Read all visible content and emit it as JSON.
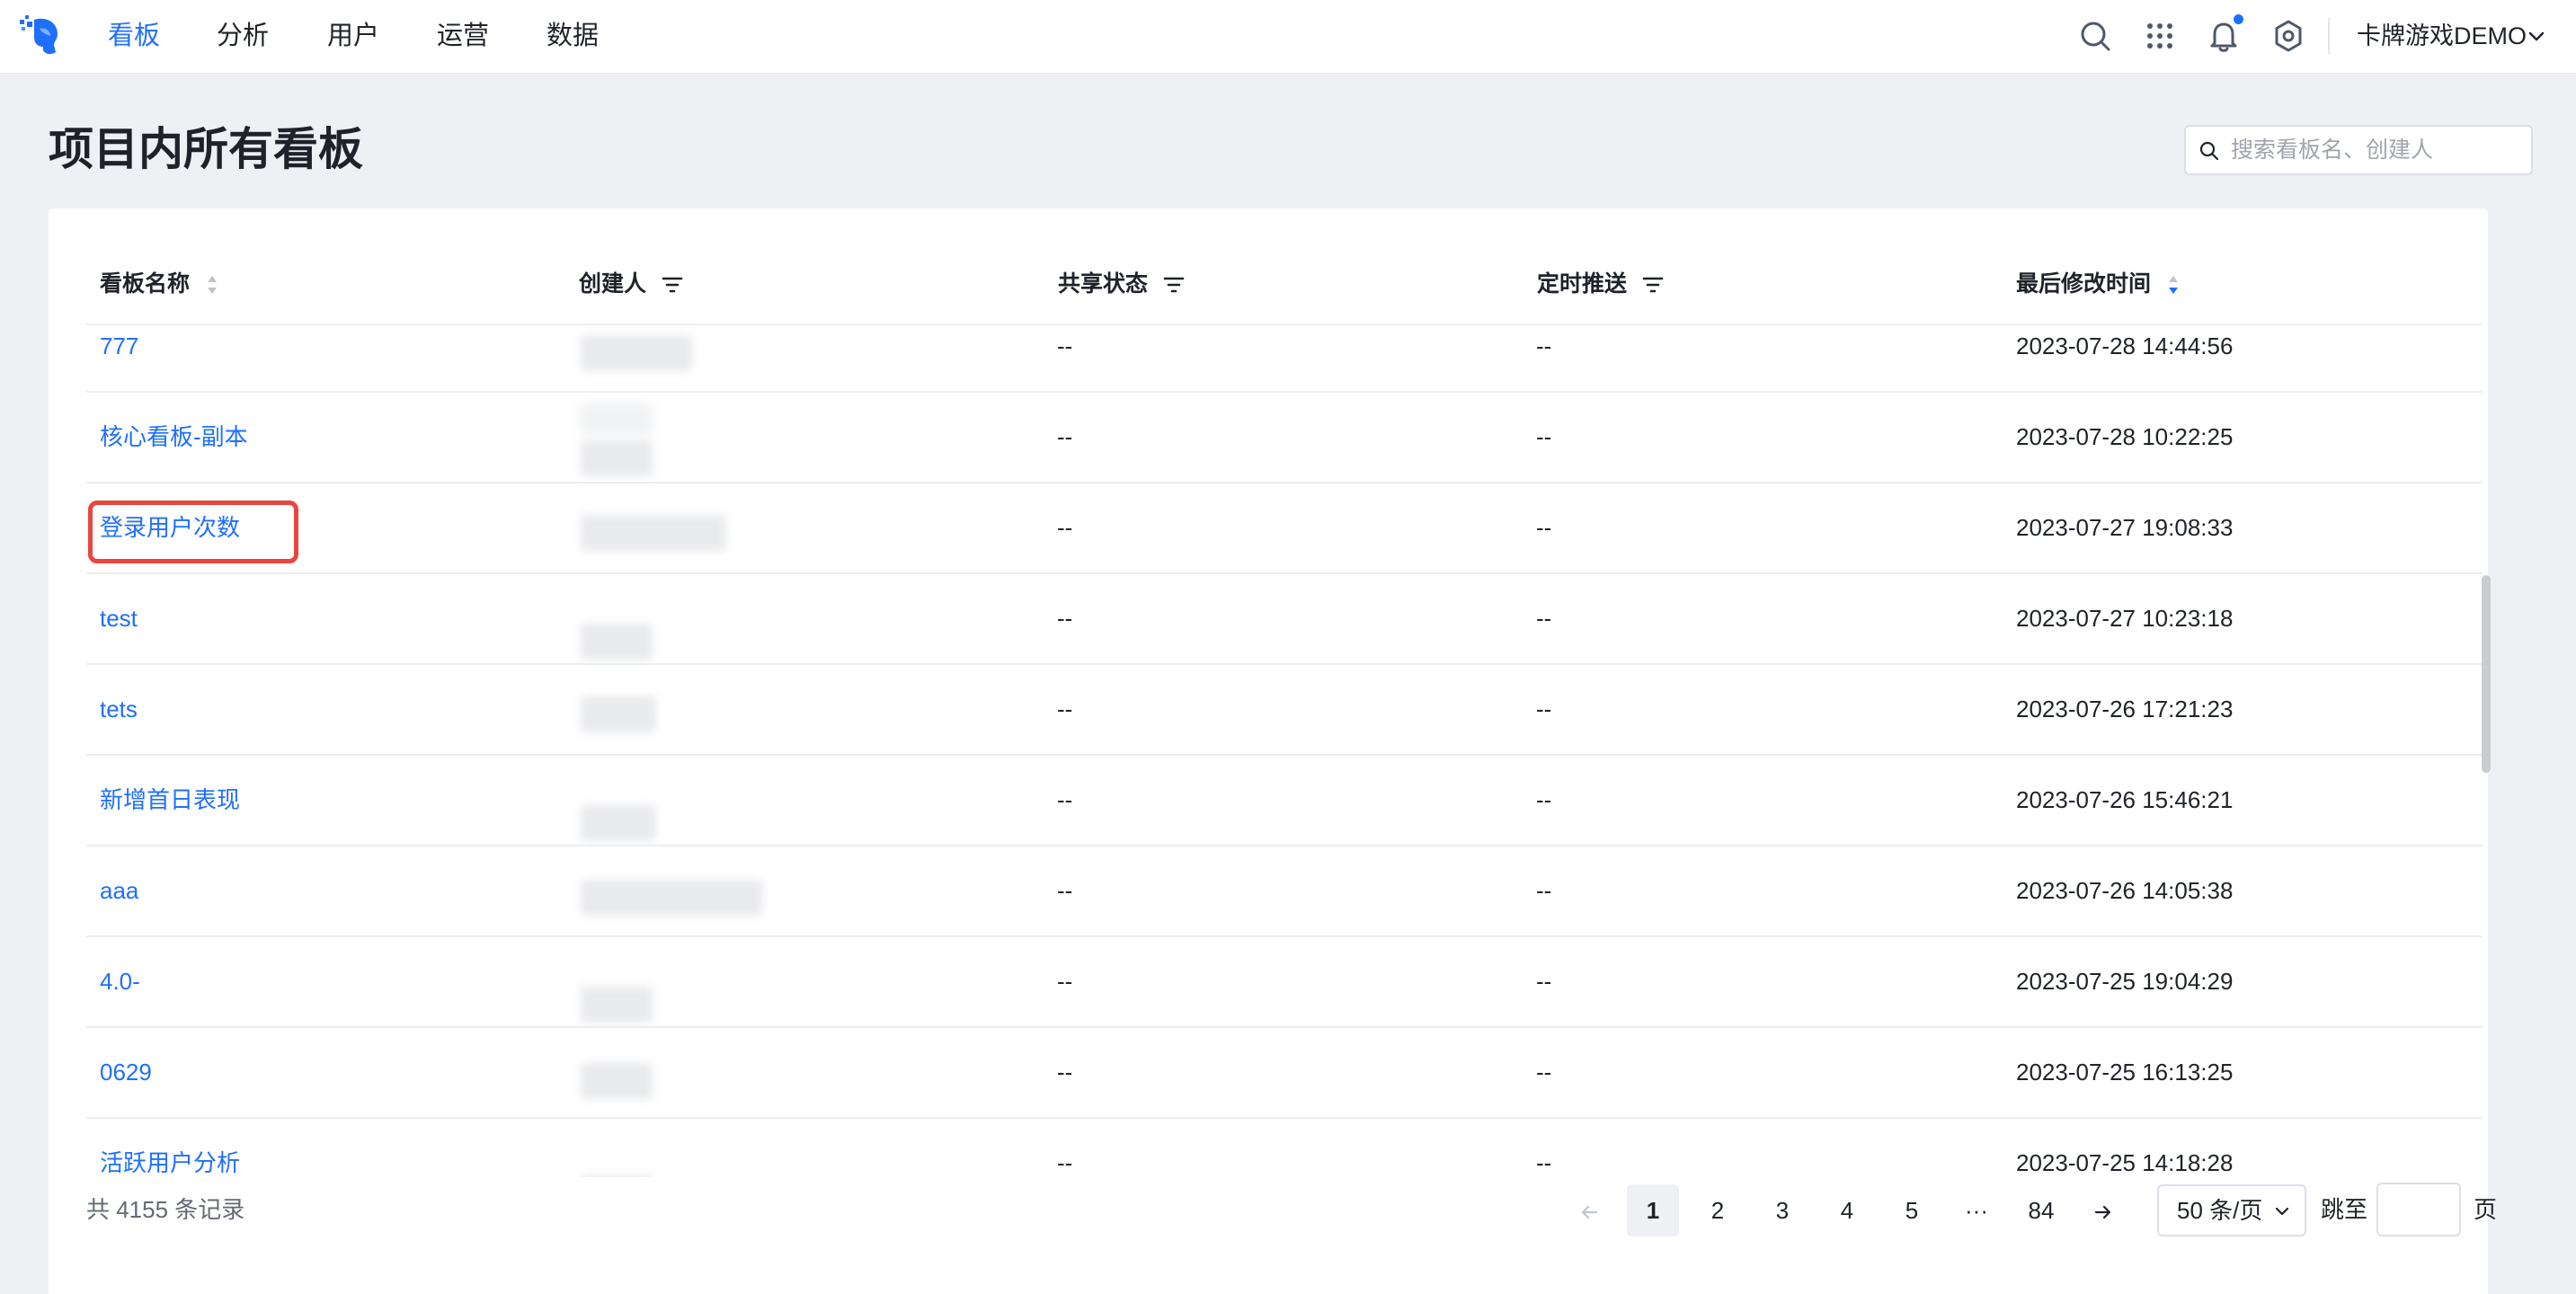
{
  "nav": {
    "items": [
      {
        "label": "看板",
        "active": true
      },
      {
        "label": "分析",
        "active": false
      },
      {
        "label": "用户",
        "active": false
      },
      {
        "label": "运营",
        "active": false
      },
      {
        "label": "数据",
        "active": false
      }
    ],
    "icons": [
      "search-icon",
      "apps-grid-icon",
      "bell-icon",
      "settings-icon"
    ],
    "project_name": "卡牌游戏DEMO",
    "accent_color": "#1f6fff"
  },
  "page": {
    "title": "项目内所有看板",
    "search_placeholder": "搜索看板名、创建人"
  },
  "table": {
    "columns": [
      {
        "label": "看板名称",
        "control": "sort"
      },
      {
        "label": "创建人",
        "control": "filter"
      },
      {
        "label": "共享状态",
        "control": "filter"
      },
      {
        "label": "定时推送",
        "control": "filter"
      },
      {
        "label": "最后修改时间",
        "control": "sort-desc"
      }
    ],
    "rows": [
      {
        "name": "777",
        "share": "--",
        "push": "--",
        "modified": "2023-07-28 14:44:56"
      },
      {
        "name": "核心看板-副本",
        "share": "--",
        "push": "--",
        "modified": "2023-07-28 10:22:25"
      },
      {
        "name": "登录用户次数",
        "share": "--",
        "push": "--",
        "modified": "2023-07-27 19:08:33",
        "highlighted": true
      },
      {
        "name": "test",
        "share": "--",
        "push": "--",
        "modified": "2023-07-27 10:23:18"
      },
      {
        "name": "tets",
        "share": "--",
        "push": "--",
        "modified": "2023-07-26 17:21:23"
      },
      {
        "name": "新增首日表现",
        "share": "--",
        "push": "--",
        "modified": "2023-07-26 15:46:21"
      },
      {
        "name": "aaa",
        "share": "--",
        "push": "--",
        "modified": "2023-07-26 14:05:38"
      },
      {
        "name": "4.0-",
        "share": "--",
        "push": "--",
        "modified": "2023-07-25 19:04:29"
      },
      {
        "name": "0629",
        "share": "--",
        "push": "--",
        "modified": "2023-07-25 16:13:25"
      },
      {
        "name": "活跃用户分析",
        "share": "--",
        "push": "--",
        "modified": "2023-07-25 14:18:28"
      }
    ]
  },
  "pagination": {
    "total_text": "共 4155 条记录",
    "pages": [
      "1",
      "2",
      "3",
      "4",
      "5",
      "···",
      "84"
    ],
    "current_page": "1",
    "page_size": "50 条/页",
    "jump_label": "跳至",
    "page_suffix": "页"
  }
}
